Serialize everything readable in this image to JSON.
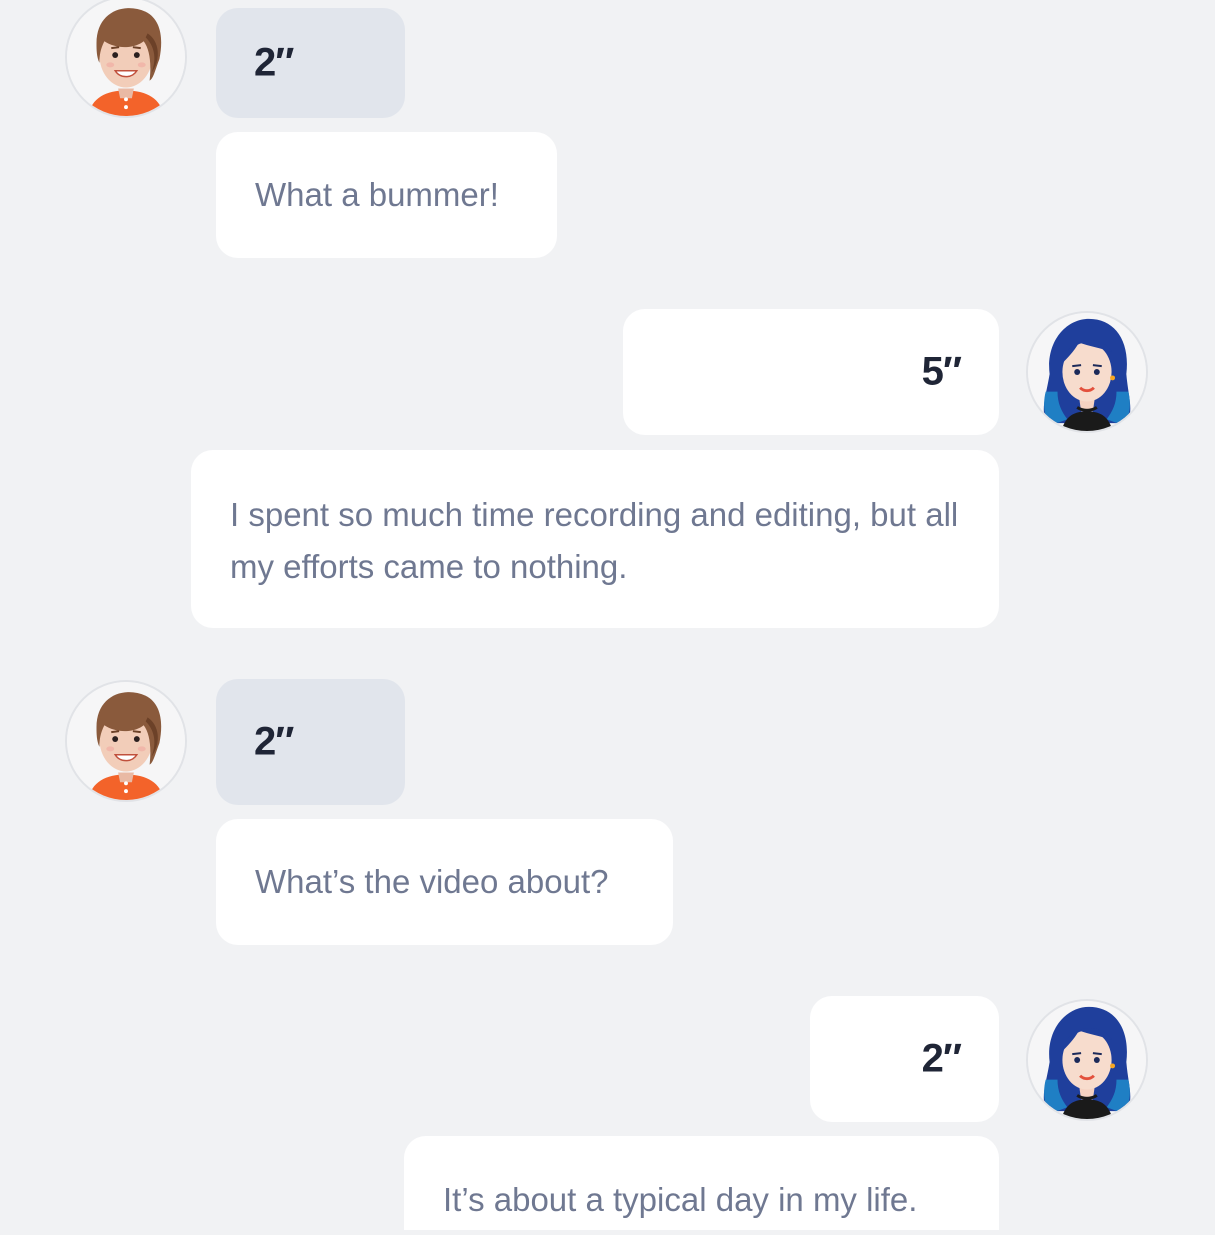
{
  "conversation": {
    "messages": [
      {
        "speaker": "boy",
        "side": "left",
        "kind": "audio",
        "duration": "2″"
      },
      {
        "speaker": "boy",
        "side": "left",
        "kind": "text",
        "text": "What a bummer!"
      },
      {
        "speaker": "girl",
        "side": "right",
        "kind": "audio",
        "duration": "5″"
      },
      {
        "speaker": "girl",
        "side": "right",
        "kind": "text",
        "text": "I spent so much time recording and editing, but all my efforts came to nothing."
      },
      {
        "speaker": "boy",
        "side": "left",
        "kind": "audio",
        "duration": "2″"
      },
      {
        "speaker": "boy",
        "side": "left",
        "kind": "text",
        "text": "What’s the video about?"
      },
      {
        "speaker": "girl",
        "side": "right",
        "kind": "audio",
        "duration": "2″"
      },
      {
        "speaker": "girl",
        "side": "right",
        "kind": "text",
        "text": "It’s about a typical day in my life."
      }
    ]
  },
  "avatars": {
    "boy": {
      "icon": "boy-avatar-icon",
      "hair": "#8a5a3c",
      "shirt": "#f3632a"
    },
    "girl": {
      "icon": "girl-avatar-icon",
      "hair": "#1f3f9c",
      "hair_tips": "#1f7fc4"
    }
  },
  "colors": {
    "background": "#f1f2f4",
    "left_audio_bubble": "#e1e5ec",
    "bubble": "#ffffff",
    "duration_text": "#1f2536",
    "message_text": "#6f7891"
  }
}
